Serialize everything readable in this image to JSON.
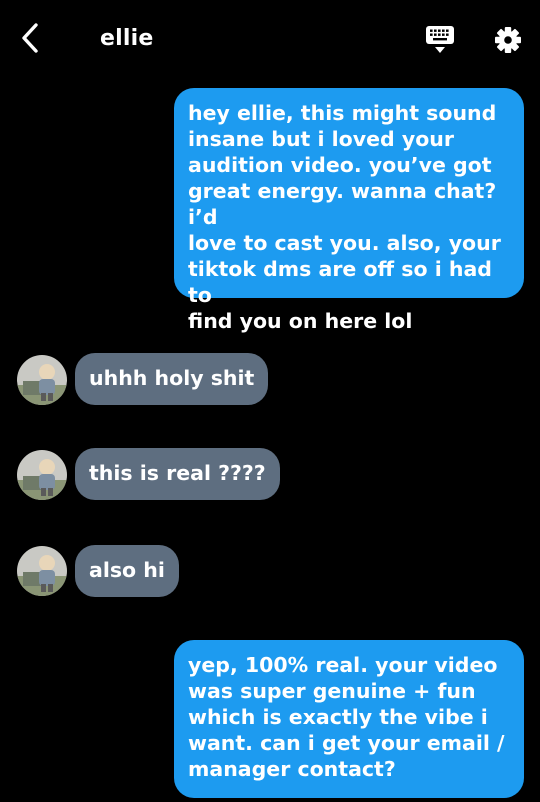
{
  "header": {
    "title": "ellie",
    "back_icon": "chevron-left-icon",
    "keyboard_icon": "keyboard-icon",
    "settings_icon": "gear-icon"
  },
  "messages": [
    {
      "from": "me",
      "text": "hey ellie, this might sound\ninsane but i loved your\naudition video. you’ve got\ngreat energy. wanna chat? i’d\nlove to cast you. also, your\ntiktok dms are off so i had to\nfind you on here lol"
    },
    {
      "from": "ellie",
      "text": "uhhh holy shit"
    },
    {
      "from": "ellie",
      "text": "this is real ????"
    },
    {
      "from": "ellie",
      "text": "also hi"
    },
    {
      "from": "me",
      "text": "yep, 100% real. your video\nwas super genuine + fun\nwhich is exactly the vibe i\nwant. can i get your email /\nmanager contact?"
    }
  ],
  "colors": {
    "background": "#000000",
    "sent_bubble": "#1d9bf0",
    "received_bubble": "#5e6e80",
    "text": "#ffffff"
  }
}
